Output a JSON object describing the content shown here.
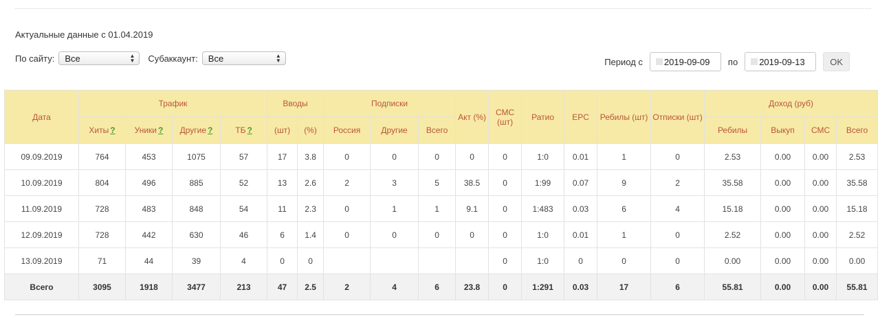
{
  "header": {
    "actual_text": "Актуальные данные с 01.04.2019"
  },
  "filters": {
    "site_label": "По сайту:",
    "site_value": "Все",
    "subaccount_label": "Субаккаунт:",
    "subaccount_value": "Все"
  },
  "period": {
    "from_label": "Период с",
    "from_value": "2019-09-09",
    "to_label": "по",
    "to_value": "2019-09-13",
    "ok_label": "OK"
  },
  "table": {
    "groups": {
      "date": "Дата",
      "traffic": "Трафик",
      "inputs": "Вводы",
      "subs": "Подписки",
      "act": "Акт (%)",
      "sms": "СМС (шт)",
      "ratio": "Ратио",
      "epc": "EPC",
      "rebills": "Ребилы (шт)",
      "unsubs": "Отписки (шт)",
      "income": "Доход (руб)"
    },
    "sub": {
      "hits": "Хиты",
      "uniques": "Уники",
      "others": "Другие",
      "tb": "ТБ",
      "inputs_count": "(шт)",
      "inputs_pct": "(%)",
      "russia": "Россия",
      "subs_other": "Другие",
      "subs_total": "Всего",
      "inc_rebills": "Ребилы",
      "inc_buyout": "Выкуп",
      "inc_sms": "СМС",
      "inc_total": "Всего"
    },
    "help_mark": "?",
    "rows": [
      [
        "09.09.2019",
        "764",
        "453",
        "1075",
        "57",
        "17",
        "3.8",
        "0",
        "0",
        "0",
        "0",
        "0",
        "1:0",
        "0.01",
        "1",
        "0",
        "2.53",
        "0.00",
        "0.00",
        "2.53"
      ],
      [
        "10.09.2019",
        "804",
        "496",
        "885",
        "52",
        "13",
        "2.6",
        "2",
        "3",
        "5",
        "38.5",
        "0",
        "1:99",
        "0.07",
        "9",
        "2",
        "35.58",
        "0.00",
        "0.00",
        "35.58"
      ],
      [
        "11.09.2019",
        "728",
        "483",
        "848",
        "54",
        "11",
        "2.3",
        "0",
        "1",
        "1",
        "9.1",
        "0",
        "1:483",
        "0.03",
        "6",
        "4",
        "15.18",
        "0.00",
        "0.00",
        "15.18"
      ],
      [
        "12.09.2019",
        "728",
        "442",
        "630",
        "46",
        "6",
        "1.4",
        "0",
        "0",
        "0",
        "0",
        "0",
        "1:0",
        "0.01",
        "1",
        "0",
        "2.52",
        "0.00",
        "0.00",
        "2.52"
      ],
      [
        "13.09.2019",
        "71",
        "44",
        "39",
        "4",
        "0",
        "0",
        "",
        "",
        "",
        "",
        "0",
        "1:0",
        "0",
        "0",
        "0",
        "0.00",
        "0.00",
        "0.00",
        "0.00"
      ]
    ],
    "total": [
      "Всего",
      "3095",
      "1918",
      "3477",
      "213",
      "47",
      "2.5",
      "2",
      "4",
      "6",
      "23.8",
      "0",
      "1:291",
      "0.03",
      "17",
      "6",
      "55.81",
      "0.00",
      "0.00",
      "55.81"
    ]
  }
}
